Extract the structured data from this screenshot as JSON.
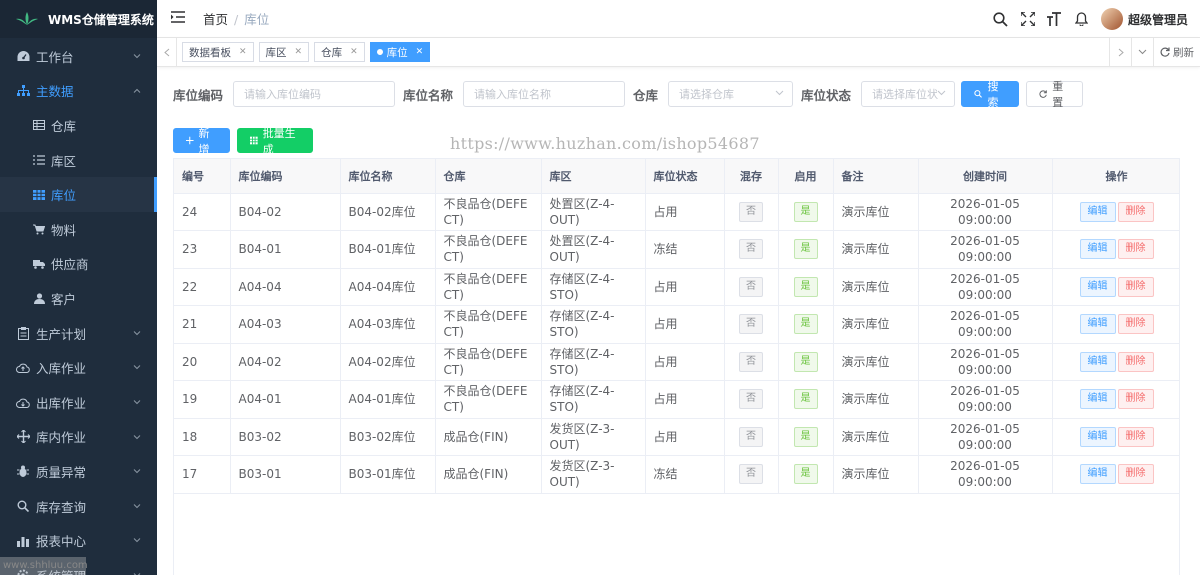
{
  "app": {
    "title": "WMS仓储管理系统"
  },
  "sidebar": {
    "items": [
      {
        "label": "工作台",
        "icon": "dashboard-icon"
      },
      {
        "label": "主数据",
        "icon": "sitemap-icon"
      },
      {
        "label": "生产计划",
        "icon": "clipboard-icon"
      },
      {
        "label": "入库作业",
        "icon": "cloud-upload-icon"
      },
      {
        "label": "出库作业",
        "icon": "cloud-download-icon"
      },
      {
        "label": "库内作业",
        "icon": "move-icon"
      },
      {
        "label": "质量异常",
        "icon": "bug-icon"
      },
      {
        "label": "库存查询",
        "icon": "search-icon"
      },
      {
        "label": "报表中心",
        "icon": "bar-chart-icon"
      },
      {
        "label": "系统管理",
        "icon": "settings-icon"
      }
    ],
    "sub_items": [
      {
        "label": "仓库",
        "icon": "table-icon"
      },
      {
        "label": "库区",
        "icon": "list-icon"
      },
      {
        "label": "库位",
        "icon": "grid-icon"
      },
      {
        "label": "物料",
        "icon": "cart-icon"
      },
      {
        "label": "供应商",
        "icon": "truck-icon"
      },
      {
        "label": "客户",
        "icon": "user-icon"
      }
    ]
  },
  "breadcrumb": {
    "home": "首页",
    "current": "库位"
  },
  "user": {
    "name": "超级管理员"
  },
  "tags": [
    {
      "label": "数据看板"
    },
    {
      "label": "库区"
    },
    {
      "label": "仓库"
    },
    {
      "label": "库位"
    }
  ],
  "tags_refresh": "刷新",
  "search": {
    "code_label": "库位编码",
    "code_placeholder": "请输入库位编码",
    "name_label": "库位名称",
    "name_placeholder": "请输入库位名称",
    "warehouse_label": "仓库",
    "warehouse_placeholder": "请选择仓库",
    "status_label": "库位状态",
    "status_placeholder": "请选择库位状",
    "search_btn": "搜索",
    "reset_btn": "重置"
  },
  "toolbar": {
    "add": "新增",
    "batch": "批量生成"
  },
  "watermark": "https://www.huzhan.com/ishop54687",
  "corner_watermark": "www.shhluu.com",
  "table": {
    "headers": [
      "编号",
      "库位编码",
      "库位名称",
      "仓库",
      "库区",
      "库位状态",
      "混存",
      "启用",
      "备注",
      "创建时间",
      "操作"
    ],
    "rows": [
      {
        "id": "24",
        "code": "B04-02",
        "name": "B04-02库位",
        "warehouse": "不良品仓(DEFECT)",
        "zone": "处置区(Z-4-OUT)",
        "status": "占用",
        "mixed": "否",
        "enabled": "是",
        "remark": "演示库位",
        "created": "2026-01-05 09:00:00"
      },
      {
        "id": "23",
        "code": "B04-01",
        "name": "B04-01库位",
        "warehouse": "不良品仓(DEFECT)",
        "zone": "处置区(Z-4-OUT)",
        "status": "冻结",
        "mixed": "否",
        "enabled": "是",
        "remark": "演示库位",
        "created": "2026-01-05 09:00:00"
      },
      {
        "id": "22",
        "code": "A04-04",
        "name": "A04-04库位",
        "warehouse": "不良品仓(DEFECT)",
        "zone": "存储区(Z-4-STO)",
        "status": "占用",
        "mixed": "否",
        "enabled": "是",
        "remark": "演示库位",
        "created": "2026-01-05 09:00:00"
      },
      {
        "id": "21",
        "code": "A04-03",
        "name": "A04-03库位",
        "warehouse": "不良品仓(DEFECT)",
        "zone": "存储区(Z-4-STO)",
        "status": "占用",
        "mixed": "否",
        "enabled": "是",
        "remark": "演示库位",
        "created": "2026-01-05 09:00:00"
      },
      {
        "id": "20",
        "code": "A04-02",
        "name": "A04-02库位",
        "warehouse": "不良品仓(DEFECT)",
        "zone": "存储区(Z-4-STO)",
        "status": "占用",
        "mixed": "否",
        "enabled": "是",
        "remark": "演示库位",
        "created": "2026-01-05 09:00:00"
      },
      {
        "id": "19",
        "code": "A04-01",
        "name": "A04-01库位",
        "warehouse": "不良品仓(DEFECT)",
        "zone": "存储区(Z-4-STO)",
        "status": "占用",
        "mixed": "否",
        "enabled": "是",
        "remark": "演示库位",
        "created": "2026-01-05 09:00:00"
      },
      {
        "id": "18",
        "code": "B03-02",
        "name": "B03-02库位",
        "warehouse": "成品仓(FIN)",
        "zone": "发货区(Z-3-OUT)",
        "status": "占用",
        "mixed": "否",
        "enabled": "是",
        "remark": "演示库位",
        "created": "2026-01-05 09:00:00"
      },
      {
        "id": "17",
        "code": "B03-01",
        "name": "B03-01库位",
        "warehouse": "成品仓(FIN)",
        "zone": "发货区(Z-3-OUT)",
        "status": "冻结",
        "mixed": "否",
        "enabled": "是",
        "remark": "演示库位",
        "created": "2026-01-05 09:00:00"
      }
    ],
    "edit_label": "编辑",
    "delete_label": "删除"
  },
  "colors": {
    "primary": "#409eff",
    "success": "#13ce66",
    "danger": "#f56c6c",
    "sidebar": "#1f2d3d"
  }
}
